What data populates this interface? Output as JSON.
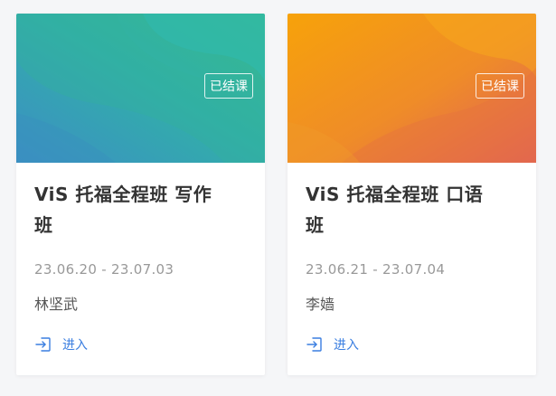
{
  "courses": [
    {
      "badge": "已结课",
      "title_line1": "ViS 托福全程班 写作",
      "title_line2": "班",
      "dates": "23.06.20 - 23.07.03",
      "teacher": "林坚武",
      "enter_label": "进入",
      "banner_colors": [
        "#3a95c2",
        "#2fb6a4",
        "#35b38a"
      ]
    },
    {
      "badge": "已结课",
      "title_line1": "ViS 托福全程班 口语",
      "title_line2": "班",
      "dates": "23.06.21 - 23.07.04",
      "teacher": "李嫱",
      "enter_label": "进入",
      "banner_colors": [
        "#f5a011",
        "#ef8a2a",
        "#e0625a"
      ]
    }
  ]
}
